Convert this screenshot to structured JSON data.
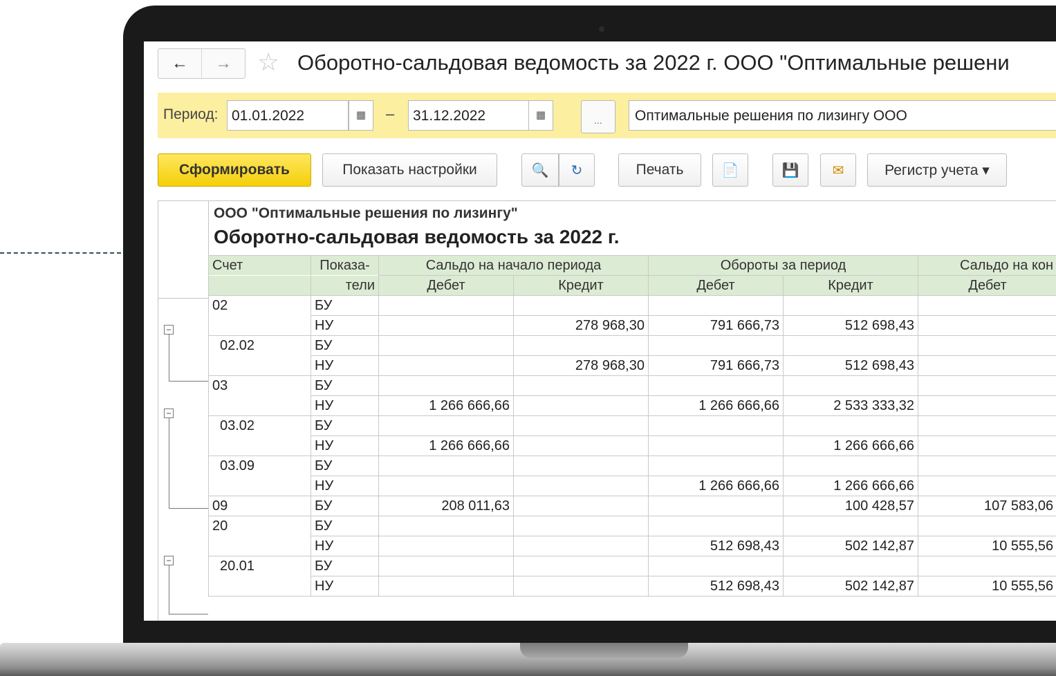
{
  "window": {
    "title": "Оборотно-сальдовая ведомость за 2022 г. ООО \"Оптимальные решени",
    "back_arrow": "←",
    "forward_arrow": "→",
    "star": "☆"
  },
  "period": {
    "label": "Период:",
    "from": "01.01.2022",
    "to": "31.12.2022",
    "dash": "–",
    "dots": "...",
    "organization": "Оптимальные решения по лизингу ООО"
  },
  "toolbar": {
    "generate": "Сформировать",
    "show_settings": "Показать настройки",
    "search": "🔍",
    "search_clear": "↻",
    "print": "Печать",
    "preview": "📄",
    "save": "💾",
    "email": "✉",
    "register": "Регистр учета ▾"
  },
  "report": {
    "org": "ООО \"Оптимальные решения по лизингу\"",
    "title": "Оборотно-сальдовая ведомость за 2022 г.",
    "headers": {
      "account": "Счет",
      "indicators_1": "Показа-",
      "indicators_2": "тели",
      "opening": "Сальдо на начало периода",
      "turnover": "Обороты за период",
      "closing": "Сальдо на кон",
      "debit": "Дебет",
      "credit": "Кредит"
    },
    "rows": [
      {
        "acct": "02",
        "ind": "БУ",
        "od": "",
        "oc": "",
        "td": "",
        "tc": "",
        "cd": ""
      },
      {
        "acct": "",
        "ind": "НУ",
        "od": "",
        "oc": "278 968,30",
        "td": "791 666,73",
        "tc": "512 698,43",
        "cd": ""
      },
      {
        "acct": "02.02",
        "ind": "БУ",
        "od": "",
        "oc": "",
        "td": "",
        "tc": "",
        "cd": ""
      },
      {
        "acct": "",
        "ind": "НУ",
        "od": "",
        "oc": "278 968,30",
        "td": "791 666,73",
        "tc": "512 698,43",
        "cd": ""
      },
      {
        "acct": "03",
        "ind": "БУ",
        "od": "",
        "oc": "",
        "td": "",
        "tc": "",
        "cd": ""
      },
      {
        "acct": "",
        "ind": "НУ",
        "od": "1 266 666,66",
        "oc": "",
        "td": "1 266 666,66",
        "tc": "2 533 333,32",
        "cd": ""
      },
      {
        "acct": "03.02",
        "ind": "БУ",
        "od": "",
        "oc": "",
        "td": "",
        "tc": "",
        "cd": ""
      },
      {
        "acct": "",
        "ind": "НУ",
        "od": "1 266 666,66",
        "oc": "",
        "td": "",
        "tc": "1 266 666,66",
        "cd": ""
      },
      {
        "acct": "03.09",
        "ind": "БУ",
        "od": "",
        "oc": "",
        "td": "",
        "tc": "",
        "cd": ""
      },
      {
        "acct": "",
        "ind": "НУ",
        "od": "",
        "oc": "",
        "td": "1 266 666,66",
        "tc": "1 266 666,66",
        "cd": ""
      },
      {
        "acct": "09",
        "ind": "БУ",
        "od": "208 011,63",
        "oc": "",
        "td": "",
        "tc": "100 428,57",
        "cd": "107 583,06"
      },
      {
        "acct": "20",
        "ind": "БУ",
        "od": "",
        "oc": "",
        "td": "",
        "tc": "",
        "cd": ""
      },
      {
        "acct": "",
        "ind": "НУ",
        "od": "",
        "oc": "",
        "td": "512 698,43",
        "tc": "502 142,87",
        "cd": "10 555,56"
      },
      {
        "acct": "20.01",
        "ind": "БУ",
        "od": "",
        "oc": "",
        "td": "",
        "tc": "",
        "cd": ""
      },
      {
        "acct": "",
        "ind": "НУ",
        "od": "",
        "oc": "",
        "td": "512 698,43",
        "tc": "502 142,87",
        "cd": "10 555,56"
      }
    ],
    "outline_collapse_symbol": "−"
  }
}
